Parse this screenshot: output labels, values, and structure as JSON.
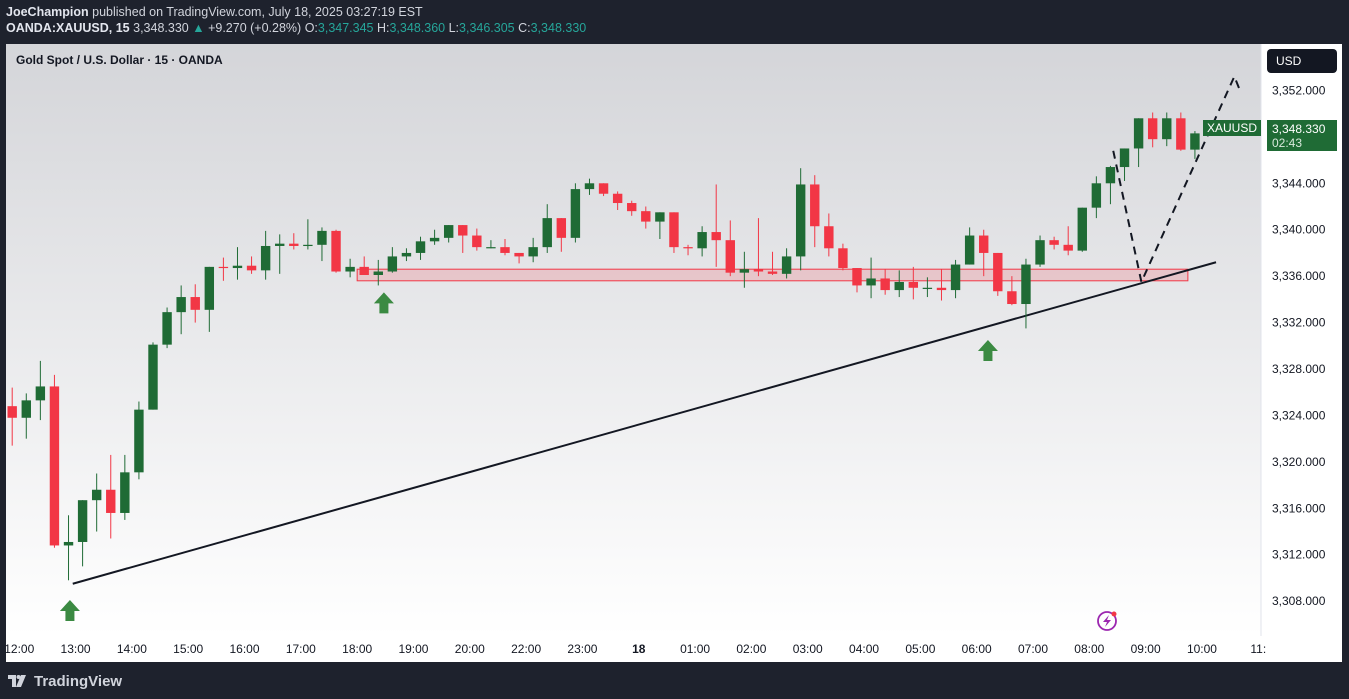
{
  "header": {
    "author": "JoeChampion",
    "published": "published on TradingView.com, July 18, 2025 03:27:19 EST",
    "symbol": "OANDA:XAUUSD, 15",
    "last": "3,348.330",
    "change_arrow": "▲",
    "change": "+9.270 (+0.28%)",
    "o_label": "O:",
    "o_value": "3,347.345",
    "h_label": "H:",
    "h_value": "3,348.360",
    "l_label": "L:",
    "l_value": "3,346.305",
    "c_label": "C:",
    "c_value": "3,348.330"
  },
  "chart_title": "Gold Spot / U.S. Dollar · 15 · OANDA",
  "currency": "USD",
  "symbol_tag": "XAUUSD",
  "price_tag": {
    "price": "3,348.330",
    "countdown": "02:43"
  },
  "footer": {
    "brand": "TradingView",
    "logo_icon": "tradingview-logo-icon"
  },
  "colors": {
    "up": "#1f6b35",
    "down": "#f23645",
    "zone": "#f23645",
    "header_green": "#26a69a"
  },
  "chart_data": {
    "type": "candlestick",
    "title": "Gold Spot / U.S. Dollar · 15 · OANDA",
    "ylim": [
      3305,
      3356
    ],
    "y_ticks": [
      "3,352.000",
      "3,348.000",
      "3,344.000",
      "3,340.000",
      "3,336.000",
      "3,332.000",
      "3,328.000",
      "3,324.000",
      "3,320.000",
      "3,316.000",
      "3,312.000",
      "3,308.000"
    ],
    "y_tick_values": [
      3352,
      3348,
      3344,
      3340,
      3336,
      3332,
      3328,
      3324,
      3320,
      3316,
      3312,
      3308
    ],
    "x_ticks": [
      "12:00",
      "13:00",
      "14:00",
      "15:00",
      "16:00",
      "17:00",
      "18:00",
      "19:00",
      "20:00",
      "22:00",
      "23:00",
      "18",
      "01:00",
      "02:00",
      "03:00",
      "04:00",
      "05:00",
      "06:00",
      "07:00",
      "08:00",
      "09:00",
      "10:00",
      "11:"
    ],
    "x_tick_bold": "18",
    "x_tick_slots": [
      0.5,
      4.5,
      8.5,
      12.5,
      16.5,
      20.5,
      24.5,
      28.5,
      32.5,
      36.5,
      40.5,
      44.5,
      48.5,
      52.5,
      56.5,
      60.5,
      64.5,
      68.5,
      72.5,
      76.5,
      80.5,
      84.5,
      88.5
    ],
    "candles": [
      {
        "o": 3324.8,
        "h": 3326.4,
        "l": 3321.4,
        "c": 3323.8
      },
      {
        "o": 3323.8,
        "h": 3325.9,
        "l": 3322.0,
        "c": 3325.3
      },
      {
        "o": 3325.3,
        "h": 3328.7,
        "l": 3323.6,
        "c": 3326.5
      },
      {
        "o": 3326.5,
        "h": 3327.5,
        "l": 3312.6,
        "c": 3312.8
      },
      {
        "o": 3312.8,
        "h": 3315.4,
        "l": 3309.8,
        "c": 3313.1
      },
      {
        "o": 3313.1,
        "h": 3316.5,
        "l": 3311.0,
        "c": 3316.7
      },
      {
        "o": 3316.7,
        "h": 3319.0,
        "l": 3314.0,
        "c": 3317.6
      },
      {
        "o": 3317.6,
        "h": 3320.6,
        "l": 3313.4,
        "c": 3315.6
      },
      {
        "o": 3315.6,
        "h": 3320.6,
        "l": 3315.0,
        "c": 3319.1
      },
      {
        "o": 3319.1,
        "h": 3325.2,
        "l": 3318.5,
        "c": 3324.5
      },
      {
        "o": 3324.5,
        "h": 3330.3,
        "l": 3324.5,
        "c": 3330.1
      },
      {
        "o": 3330.1,
        "h": 3333.3,
        "l": 3329.8,
        "c": 3332.9
      },
      {
        "o": 3332.9,
        "h": 3335.2,
        "l": 3331.0,
        "c": 3334.2
      },
      {
        "o": 3334.2,
        "h": 3335.3,
        "l": 3332.0,
        "c": 3333.1
      },
      {
        "o": 3333.1,
        "h": 3335.3,
        "l": 3331.2,
        "c": 3336.8
      },
      {
        "o": 3336.8,
        "h": 3337.6,
        "l": 3335.6,
        "c": 3336.7
      },
      {
        "o": 3336.7,
        "h": 3338.5,
        "l": 3335.7,
        "c": 3336.9
      },
      {
        "o": 3336.9,
        "h": 3337.7,
        "l": 3336.2,
        "c": 3336.5
      },
      {
        "o": 3336.5,
        "h": 3339.9,
        "l": 3335.7,
        "c": 3338.6
      },
      {
        "o": 3338.6,
        "h": 3339.6,
        "l": 3336.2,
        "c": 3338.8
      },
      {
        "o": 3338.8,
        "h": 3339.7,
        "l": 3338.3,
        "c": 3338.6
      },
      {
        "o": 3338.6,
        "h": 3340.9,
        "l": 3338.3,
        "c": 3338.7
      },
      {
        "o": 3338.7,
        "h": 3340.2,
        "l": 3337.3,
        "c": 3339.9
      },
      {
        "o": 3339.9,
        "h": 3340.0,
        "l": 3336.3,
        "c": 3336.4
      },
      {
        "o": 3336.4,
        "h": 3337.5,
        "l": 3335.9,
        "c": 3336.8
      },
      {
        "o": 3336.8,
        "h": 3337.7,
        "l": 3336.2,
        "c": 3336.1
      },
      {
        "o": 3336.1,
        "h": 3337.4,
        "l": 3335.2,
        "c": 3336.4
      },
      {
        "o": 3336.4,
        "h": 3338.5,
        "l": 3336.3,
        "c": 3337.7
      },
      {
        "o": 3337.7,
        "h": 3338.4,
        "l": 3337.3,
        "c": 3338.0
      },
      {
        "o": 3338.0,
        "h": 3339.4,
        "l": 3337.4,
        "c": 3339.0
      },
      {
        "o": 3339.0,
        "h": 3340.0,
        "l": 3338.7,
        "c": 3339.3
      },
      {
        "o": 3339.3,
        "h": 3340.2,
        "l": 3338.9,
        "c": 3340.4
      },
      {
        "o": 3340.4,
        "h": 3340.4,
        "l": 3338.0,
        "c": 3339.5
      },
      {
        "o": 3339.5,
        "h": 3340.1,
        "l": 3338.2,
        "c": 3338.5
      },
      {
        "o": 3338.5,
        "h": 3339.1,
        "l": 3338.4,
        "c": 3338.5
      },
      {
        "o": 3338.5,
        "h": 3339.2,
        "l": 3337.8,
        "c": 3338.0
      },
      {
        "o": 3338.0,
        "h": 3337.9,
        "l": 3337.1,
        "c": 3337.7
      },
      {
        "o": 3337.7,
        "h": 3339.3,
        "l": 3337.2,
        "c": 3338.5
      },
      {
        "o": 3338.5,
        "h": 3342.2,
        "l": 3338.0,
        "c": 3341.0
      },
      {
        "o": 3341.0,
        "h": 3340.5,
        "l": 3338.1,
        "c": 3339.3
      },
      {
        "o": 3339.3,
        "h": 3344.0,
        "l": 3338.9,
        "c": 3343.5
      },
      {
        "o": 3343.5,
        "h": 3344.4,
        "l": 3343.0,
        "c": 3344.0
      },
      {
        "o": 3344.0,
        "h": 3344.0,
        "l": 3342.9,
        "c": 3343.1
      },
      {
        "o": 3343.1,
        "h": 3343.3,
        "l": 3341.7,
        "c": 3342.3
      },
      {
        "o": 3342.3,
        "h": 3342.5,
        "l": 3341.2,
        "c": 3341.6
      },
      {
        "o": 3341.6,
        "h": 3342.0,
        "l": 3340.1,
        "c": 3340.7
      },
      {
        "o": 3340.7,
        "h": 3341.5,
        "l": 3339.2,
        "c": 3341.5
      },
      {
        "o": 3341.5,
        "h": 3341.5,
        "l": 3338.0,
        "c": 3338.5
      },
      {
        "o": 3338.5,
        "h": 3338.7,
        "l": 3337.8,
        "c": 3338.4
      },
      {
        "o": 3338.4,
        "h": 3340.3,
        "l": 3337.7,
        "c": 3339.8
      },
      {
        "o": 3339.8,
        "h": 3343.9,
        "l": 3336.8,
        "c": 3339.1
      },
      {
        "o": 3339.1,
        "h": 3340.8,
        "l": 3336.0,
        "c": 3336.3
      },
      {
        "o": 3336.3,
        "h": 3338.1,
        "l": 3335.0,
        "c": 3336.6
      },
      {
        "o": 3336.6,
        "h": 3341.0,
        "l": 3336.0,
        "c": 3336.4
      },
      {
        "o": 3336.4,
        "h": 3338.1,
        "l": 3336.1,
        "c": 3336.2
      },
      {
        "o": 3336.2,
        "h": 3338.4,
        "l": 3335.8,
        "c": 3337.7
      },
      {
        "o": 3337.7,
        "h": 3345.3,
        "l": 3336.5,
        "c": 3343.9
      },
      {
        "o": 3343.9,
        "h": 3344.7,
        "l": 3338.5,
        "c": 3340.3
      },
      {
        "o": 3340.3,
        "h": 3341.4,
        "l": 3337.7,
        "c": 3338.4
      },
      {
        "o": 3338.4,
        "h": 3338.8,
        "l": 3336.5,
        "c": 3336.7
      },
      {
        "o": 3336.7,
        "h": 3336.7,
        "l": 3334.6,
        "c": 3335.2
      },
      {
        "o": 3335.2,
        "h": 3337.6,
        "l": 3334.1,
        "c": 3335.8
      },
      {
        "o": 3335.8,
        "h": 3336.6,
        "l": 3334.4,
        "c": 3334.8
      },
      {
        "o": 3334.8,
        "h": 3336.5,
        "l": 3334.2,
        "c": 3335.5
      },
      {
        "o": 3335.5,
        "h": 3336.8,
        "l": 3334.0,
        "c": 3335.0
      },
      {
        "o": 3335.0,
        "h": 3335.9,
        "l": 3334.2,
        "c": 3335.0
      },
      {
        "o": 3335.0,
        "h": 3336.6,
        "l": 3333.9,
        "c": 3334.8
      },
      {
        "o": 3334.8,
        "h": 3337.4,
        "l": 3334.1,
        "c": 3337.0
      },
      {
        "o": 3337.0,
        "h": 3340.2,
        "l": 3337.0,
        "c": 3339.5
      },
      {
        "o": 3339.5,
        "h": 3340.0,
        "l": 3336.0,
        "c": 3338.0
      },
      {
        "o": 3338.0,
        "h": 3338.0,
        "l": 3334.3,
        "c": 3334.7
      },
      {
        "o": 3334.7,
        "h": 3336.0,
        "l": 3333.5,
        "c": 3333.6
      },
      {
        "o": 3333.6,
        "h": 3337.5,
        "l": 3331.5,
        "c": 3337.0
      },
      {
        "o": 3337.0,
        "h": 3339.5,
        "l": 3336.8,
        "c": 3339.1
      },
      {
        "o": 3339.1,
        "h": 3339.4,
        "l": 3338.3,
        "c": 3338.7
      },
      {
        "o": 3338.7,
        "h": 3340.3,
        "l": 3337.8,
        "c": 3338.2
      },
      {
        "o": 3338.2,
        "h": 3341.9,
        "l": 3338.1,
        "c": 3341.9
      },
      {
        "o": 3341.9,
        "h": 3344.6,
        "l": 3341.0,
        "c": 3344.0
      },
      {
        "o": 3344.0,
        "h": 3345.5,
        "l": 3342.2,
        "c": 3345.4
      },
      {
        "o": 3345.4,
        "h": 3346.9,
        "l": 3344.2,
        "c": 3347.0
      },
      {
        "o": 3347.0,
        "h": 3347.7,
        "l": 3345.4,
        "c": 3349.6
      },
      {
        "o": 3349.6,
        "h": 3350.1,
        "l": 3347.1,
        "c": 3347.8
      },
      {
        "o": 3347.8,
        "h": 3350.1,
        "l": 3347.2,
        "c": 3349.6
      },
      {
        "o": 3349.6,
        "h": 3350.1,
        "l": 3346.8,
        "c": 3346.9
      },
      {
        "o": 3346.9,
        "h": 3348.5,
        "l": 3346.1,
        "c": 3348.3
      }
    ],
    "support_zone": {
      "from_slot": 24.5,
      "to_slot": 83.5,
      "top": 3336.6,
      "bottom": 3335.6
    },
    "trendline": {
      "from": {
        "slot": 4.3,
        "value": 3309.5
      },
      "to": {
        "slot": 85.5,
        "value": 3337.2
      }
    },
    "projection": [
      {
        "slot": 78.2,
        "value": 3346.8
      },
      {
        "slot": 80.2,
        "value": 3335.5
      },
      {
        "slot": 86.8,
        "value": 3353.2
      },
      {
        "slot": 87.2,
        "value": 3352.0
      }
    ],
    "markers": [
      {
        "type": "arrow-up",
        "slot": 4.1,
        "value": 3308.1
      },
      {
        "type": "arrow-up",
        "slot": 26.4,
        "value": 3334.6
      },
      {
        "type": "arrow-up",
        "slot": 69.3,
        "value": 3330.5
      }
    ]
  }
}
